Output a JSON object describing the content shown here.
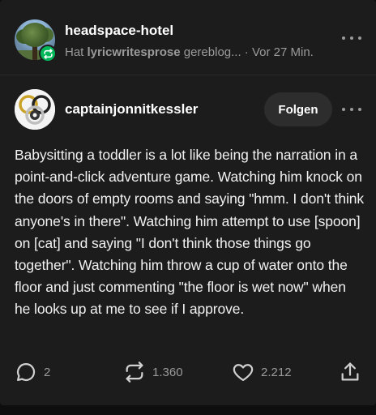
{
  "reblog": {
    "blog_name": "headspace-hotel",
    "meta_prefix": "Hat",
    "source_user": "lyricwritesprose",
    "meta_suffix": "gereblog... · Vor 27 Min."
  },
  "post": {
    "author": "captainjonnitkessler",
    "follow_label": "Folgen",
    "body": "Babysitting a toddler is a lot like being the narration in a point-and-click adventure game. Watching him knock on the doors of empty rooms and saying \"hmm. I don't think anyone's in there\". Watching him attempt to use [spoon] on [cat] and saying \"I don't think those things go together\". Watching him throw a cup of water onto the floor and just commenting \"the floor is wet now\" when he looks up at me to see if I approve."
  },
  "footer": {
    "comments": "2",
    "reblogs": "1.360",
    "likes": "2.212"
  },
  "colors": {
    "background": "#1c1c1d",
    "reblog_green": "#00b85a",
    "muted_text": "#9a9a9a",
    "follow_button": "#2d2d2e"
  },
  "icons": {
    "reblog_badge": "reblog-icon",
    "comment": "comment-icon",
    "reblog": "reblog-icon",
    "like": "heart-icon",
    "share": "share-icon",
    "more": "more-dots-icon"
  }
}
